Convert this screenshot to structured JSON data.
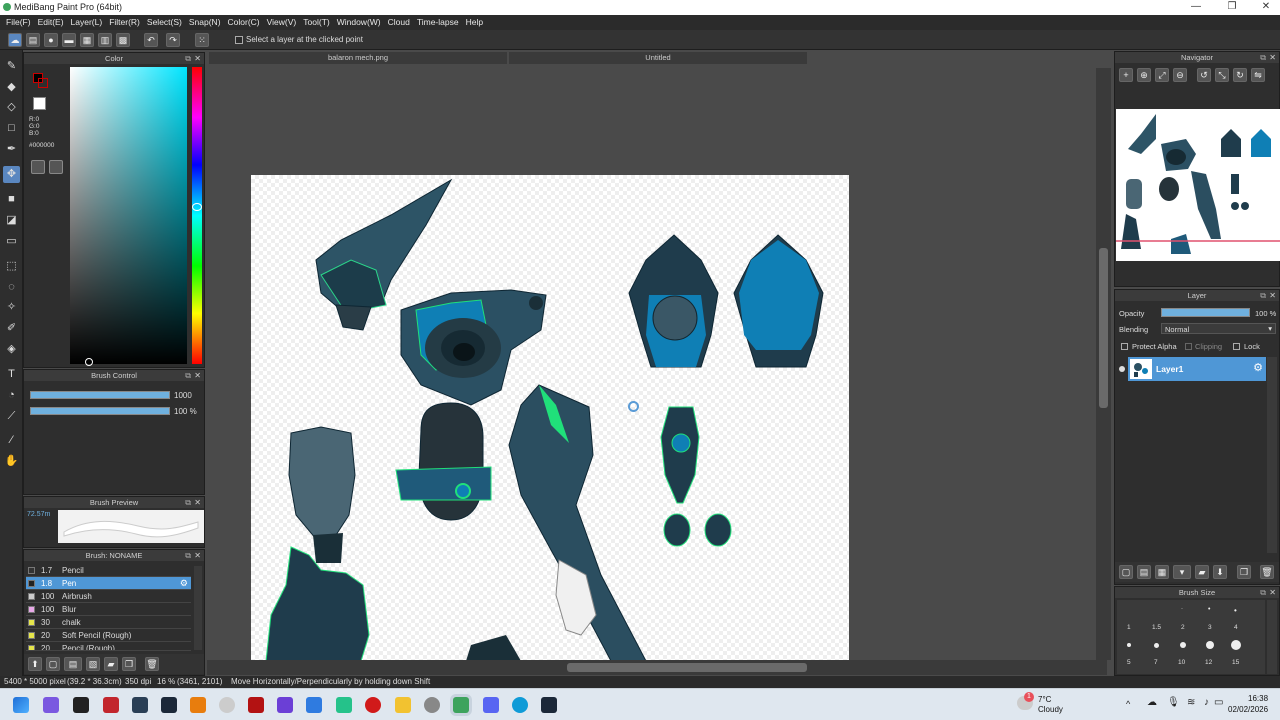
{
  "window": {
    "title": "MediBang Paint Pro (64bit)",
    "minimize": "—",
    "maximize": "❐",
    "close": "✕"
  },
  "menu": [
    "File(F)",
    "Edit(E)",
    "Layer(L)",
    "Filter(R)",
    "Select(S)",
    "Snap(N)",
    "Color(C)",
    "View(V)",
    "Tool(T)",
    "Window(W)",
    "Cloud",
    "Time-lapse",
    "Help"
  ],
  "toolbar": {
    "select_layer_label": "Select a layer at the clicked point"
  },
  "tabs": {
    "tab1": "balaron mech.png",
    "tab2": "Untitled"
  },
  "color_panel": {
    "title": "Color",
    "r": "R:0",
    "g": "G:0",
    "b": "B:0",
    "hex": "#000000",
    "fg_color": "#000000"
  },
  "brush_control": {
    "title": "Brush Control",
    "size_value": "1000",
    "opacity_value": "100 %"
  },
  "brush_preview": {
    "title": "Brush Preview",
    "size_label": "72.57m"
  },
  "brush_list": {
    "title": "Brush: NONAME",
    "items": [
      {
        "size": "1.7",
        "name": "Pencil",
        "color": "#333333"
      },
      {
        "size": "1.8",
        "name": "Pen",
        "color": "#222222"
      },
      {
        "size": "100",
        "name": "Airbrush",
        "color": "#cccccc"
      },
      {
        "size": "100",
        "name": "Blur",
        "color": "#e8a8e8"
      },
      {
        "size": "30",
        "name": "chalk",
        "color": "#e5e54a"
      },
      {
        "size": "20",
        "name": "Soft Pencil (Rough)",
        "color": "#e5e54a"
      },
      {
        "size": "20",
        "name": "Pencil (Rough)",
        "color": "#e5e54a"
      }
    ]
  },
  "navigator": {
    "title": "Navigator"
  },
  "layer_panel": {
    "title": "Layer",
    "opacity_label": "Opacity",
    "opacity_value": "100 %",
    "opacity_fraction": 1.0,
    "blending_label": "Blending",
    "blending_value": "Normal",
    "protect_alpha": "Protect Alpha",
    "clipping": "Clipping",
    "lock": "Lock",
    "layer_name": "Layer1"
  },
  "brush_size": {
    "title": "Brush Size",
    "values": [
      "1",
      "1.5",
      "2",
      "3",
      "4",
      "5",
      "7",
      "10",
      "12",
      "15"
    ]
  },
  "status": {
    "dimensions": "5400 * 5000 pixel",
    "physical": "(39.2 * 36.3cm)",
    "dpi": "350 dpi",
    "zoom": "16 %",
    "coords": "(3461, 2101)",
    "hint": "Move Horizontally/Perpendicularly by holding down Shift"
  },
  "taskbar": {
    "temp": "7°C",
    "weather": "Cloudy",
    "time": "16:38",
    "date": "02/02/2026",
    "notif": "1"
  }
}
